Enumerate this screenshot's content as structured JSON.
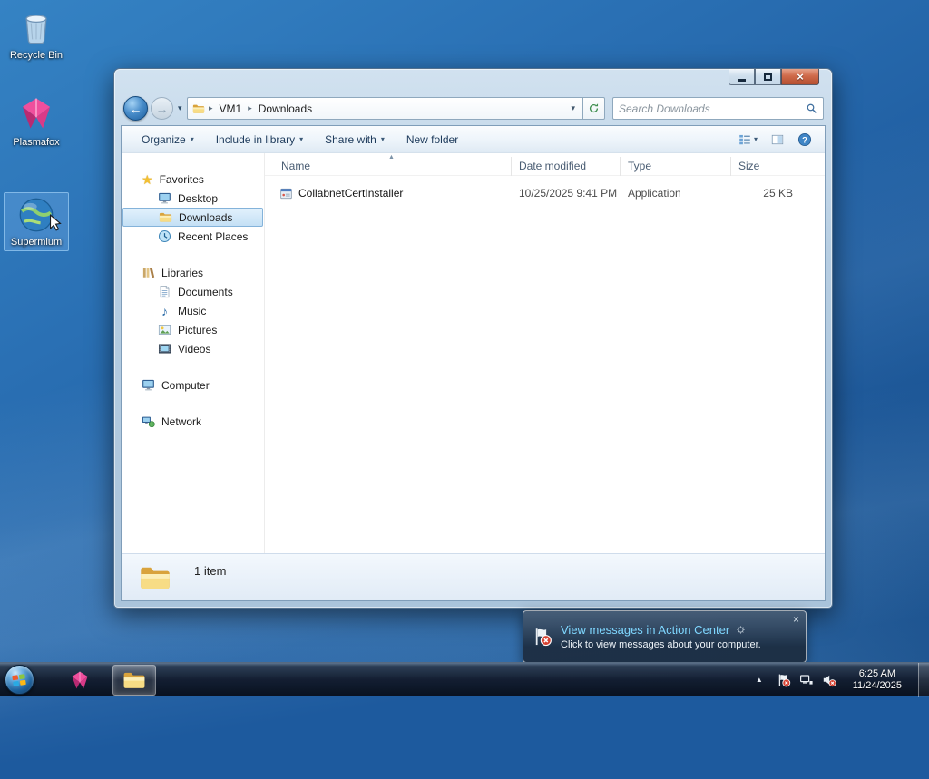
{
  "colors": {
    "desktop_blue": "#2a70b4",
    "selection_blue": "#c4e0f5",
    "notification_title_blue": "#7fd7ff",
    "taskbar_dark": "#0e1c2e",
    "close_button_red": "#cf6a4a"
  },
  "icons": {
    "chevron_down": "▾",
    "back_arrow": "←",
    "forward_arrow": "→",
    "star": "★",
    "music_note": "♪",
    "close": "×",
    "sort_asc": "▲",
    "tray_expand": "▲"
  },
  "desktop": {
    "icons": [
      {
        "label": "Recycle Bin"
      },
      {
        "label": "Plasmafox"
      },
      {
        "label": "Supermium"
      }
    ]
  },
  "window": {
    "address": {
      "crumbs": [
        "VM1",
        "Downloads"
      ],
      "separator": "▸"
    },
    "search": {
      "placeholder": "Search Downloads"
    },
    "toolbar": {
      "items": [
        "Organize",
        "Include in library",
        "Share with",
        "New folder"
      ]
    },
    "sidebar": {
      "sections": [
        {
          "label": "Favorites",
          "children": [
            "Desktop",
            "Downloads",
            "Recent Places"
          ]
        },
        {
          "label": "Libraries",
          "children": [
            "Documents",
            "Music",
            "Pictures",
            "Videos"
          ]
        },
        {
          "label": "Computer",
          "children": []
        },
        {
          "label": "Network",
          "children": []
        }
      ],
      "selected": "Downloads"
    },
    "list": {
      "columns": [
        "Name",
        "Date modified",
        "Type",
        "Size"
      ],
      "rows": [
        {
          "name": "CollabnetCertInstaller",
          "date_modified": "10/25/2025 9:41 PM",
          "type": "Application",
          "size": "25 KB"
        }
      ]
    },
    "statusbar": {
      "count": "1 item"
    }
  },
  "notification": {
    "title": "View messages in Action Center",
    "body": "Click to view messages about your computer."
  },
  "taskbar": {
    "clock": {
      "time": "6:25 AM",
      "date": "11/24/2025"
    }
  }
}
